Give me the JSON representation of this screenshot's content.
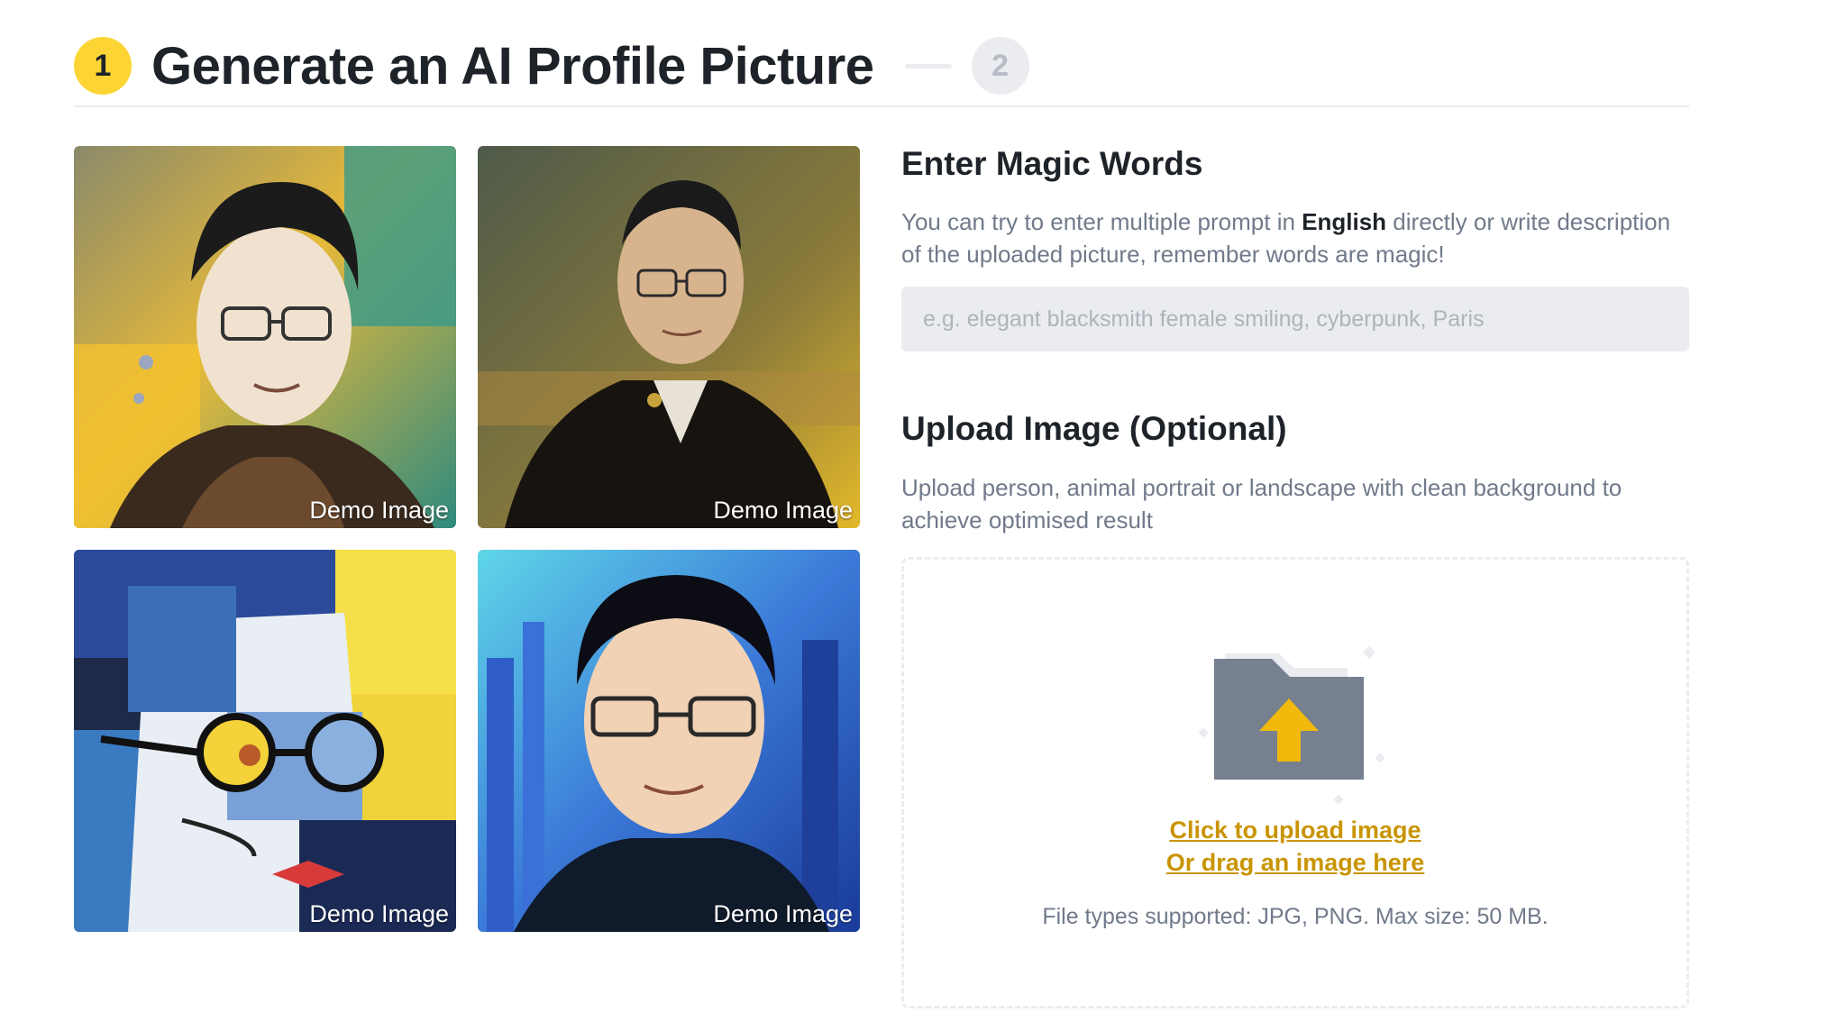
{
  "header": {
    "step1_number": "1",
    "title": "Generate an AI Profile Picture",
    "step2_number": "2"
  },
  "gallery": {
    "items": [
      {
        "label": "Demo Image"
      },
      {
        "label": "Demo Image"
      },
      {
        "label": "Demo Image"
      },
      {
        "label": "Demo Image"
      }
    ]
  },
  "magic_words": {
    "title": "Enter Magic Words",
    "desc_before": "You can try to enter multiple prompt in ",
    "desc_bold": "English",
    "desc_after": " directly or write description of the uploaded picture, remember words are magic!",
    "placeholder": "e.g. elegant blacksmith female smiling, cyberpunk, Paris"
  },
  "upload": {
    "title": "Upload Image (Optional)",
    "desc": "Upload person, animal portrait or landscape with clean background to achieve optimised result",
    "click_label": "Click to upload image",
    "drag_label": "Or drag an image here",
    "hint": "File types supported: JPG, PNG. Max size: 50 MB."
  },
  "colors": {
    "brand_yellow": "#fcd535",
    "link": "#c99400",
    "text_primary": "#1e2329",
    "text_secondary": "#707a8a",
    "input_bg": "#eaecef"
  },
  "icons": {
    "upload": "folder-upload-icon"
  }
}
